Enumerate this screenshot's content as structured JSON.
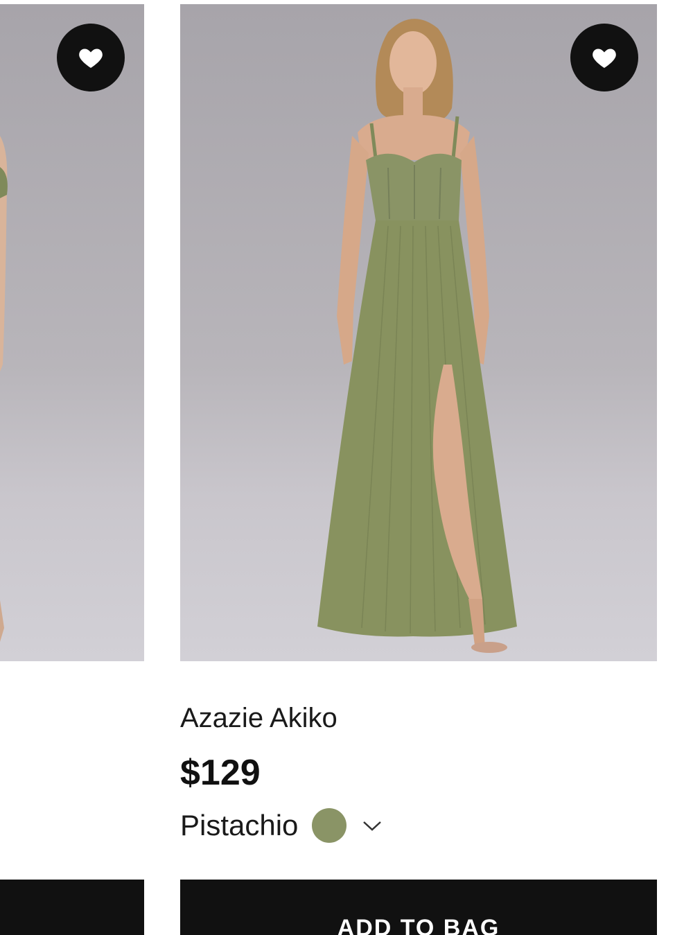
{
  "cards": {
    "left": {
      "favorite_icon": "heart-icon"
    },
    "right": {
      "favorite_icon": "heart-icon",
      "title": "Azazie Akiko",
      "price": "$129",
      "color_name": "Pistachio",
      "swatch_color": "#8a9466",
      "dropdown_icon": "chevron-down-icon",
      "button_label": "ADD TO BAG"
    }
  }
}
